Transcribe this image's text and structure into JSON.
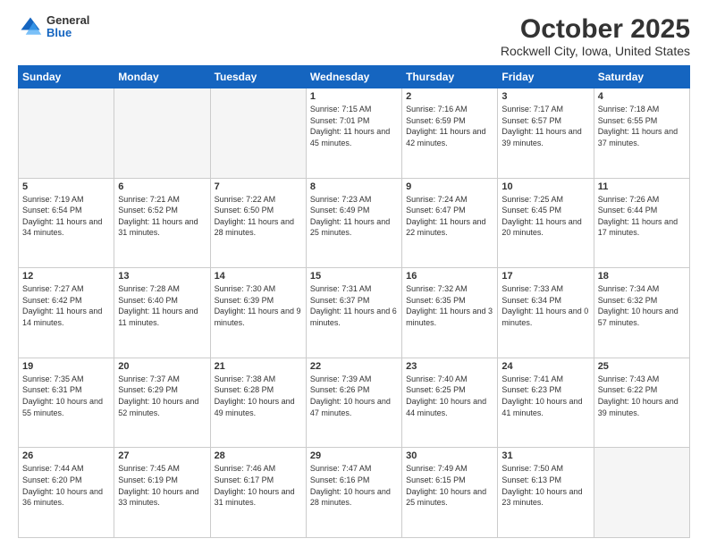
{
  "header": {
    "logo_general": "General",
    "logo_blue": "Blue",
    "month_title": "October 2025",
    "location": "Rockwell City, Iowa, United States"
  },
  "days_of_week": [
    "Sunday",
    "Monday",
    "Tuesday",
    "Wednesday",
    "Thursday",
    "Friday",
    "Saturday"
  ],
  "weeks": [
    [
      {
        "num": "",
        "empty": true
      },
      {
        "num": "",
        "empty": true
      },
      {
        "num": "",
        "empty": true
      },
      {
        "num": "1",
        "sunrise": "7:15 AM",
        "sunset": "7:01 PM",
        "daylight": "11 hours and 45 minutes."
      },
      {
        "num": "2",
        "sunrise": "7:16 AM",
        "sunset": "6:59 PM",
        "daylight": "11 hours and 42 minutes."
      },
      {
        "num": "3",
        "sunrise": "7:17 AM",
        "sunset": "6:57 PM",
        "daylight": "11 hours and 39 minutes."
      },
      {
        "num": "4",
        "sunrise": "7:18 AM",
        "sunset": "6:55 PM",
        "daylight": "11 hours and 37 minutes."
      }
    ],
    [
      {
        "num": "5",
        "sunrise": "7:19 AM",
        "sunset": "6:54 PM",
        "daylight": "11 hours and 34 minutes."
      },
      {
        "num": "6",
        "sunrise": "7:21 AM",
        "sunset": "6:52 PM",
        "daylight": "11 hours and 31 minutes."
      },
      {
        "num": "7",
        "sunrise": "7:22 AM",
        "sunset": "6:50 PM",
        "daylight": "11 hours and 28 minutes."
      },
      {
        "num": "8",
        "sunrise": "7:23 AM",
        "sunset": "6:49 PM",
        "daylight": "11 hours and 25 minutes."
      },
      {
        "num": "9",
        "sunrise": "7:24 AM",
        "sunset": "6:47 PM",
        "daylight": "11 hours and 22 minutes."
      },
      {
        "num": "10",
        "sunrise": "7:25 AM",
        "sunset": "6:45 PM",
        "daylight": "11 hours and 20 minutes."
      },
      {
        "num": "11",
        "sunrise": "7:26 AM",
        "sunset": "6:44 PM",
        "daylight": "11 hours and 17 minutes."
      }
    ],
    [
      {
        "num": "12",
        "sunrise": "7:27 AM",
        "sunset": "6:42 PM",
        "daylight": "11 hours and 14 minutes."
      },
      {
        "num": "13",
        "sunrise": "7:28 AM",
        "sunset": "6:40 PM",
        "daylight": "11 hours and 11 minutes."
      },
      {
        "num": "14",
        "sunrise": "7:30 AM",
        "sunset": "6:39 PM",
        "daylight": "11 hours and 9 minutes."
      },
      {
        "num": "15",
        "sunrise": "7:31 AM",
        "sunset": "6:37 PM",
        "daylight": "11 hours and 6 minutes."
      },
      {
        "num": "16",
        "sunrise": "7:32 AM",
        "sunset": "6:35 PM",
        "daylight": "11 hours and 3 minutes."
      },
      {
        "num": "17",
        "sunrise": "7:33 AM",
        "sunset": "6:34 PM",
        "daylight": "11 hours and 0 minutes."
      },
      {
        "num": "18",
        "sunrise": "7:34 AM",
        "sunset": "6:32 PM",
        "daylight": "10 hours and 57 minutes."
      }
    ],
    [
      {
        "num": "19",
        "sunrise": "7:35 AM",
        "sunset": "6:31 PM",
        "daylight": "10 hours and 55 minutes."
      },
      {
        "num": "20",
        "sunrise": "7:37 AM",
        "sunset": "6:29 PM",
        "daylight": "10 hours and 52 minutes."
      },
      {
        "num": "21",
        "sunrise": "7:38 AM",
        "sunset": "6:28 PM",
        "daylight": "10 hours and 49 minutes."
      },
      {
        "num": "22",
        "sunrise": "7:39 AM",
        "sunset": "6:26 PM",
        "daylight": "10 hours and 47 minutes."
      },
      {
        "num": "23",
        "sunrise": "7:40 AM",
        "sunset": "6:25 PM",
        "daylight": "10 hours and 44 minutes."
      },
      {
        "num": "24",
        "sunrise": "7:41 AM",
        "sunset": "6:23 PM",
        "daylight": "10 hours and 41 minutes."
      },
      {
        "num": "25",
        "sunrise": "7:43 AM",
        "sunset": "6:22 PM",
        "daylight": "10 hours and 39 minutes."
      }
    ],
    [
      {
        "num": "26",
        "sunrise": "7:44 AM",
        "sunset": "6:20 PM",
        "daylight": "10 hours and 36 minutes."
      },
      {
        "num": "27",
        "sunrise": "7:45 AM",
        "sunset": "6:19 PM",
        "daylight": "10 hours and 33 minutes."
      },
      {
        "num": "28",
        "sunrise": "7:46 AM",
        "sunset": "6:17 PM",
        "daylight": "10 hours and 31 minutes."
      },
      {
        "num": "29",
        "sunrise": "7:47 AM",
        "sunset": "6:16 PM",
        "daylight": "10 hours and 28 minutes."
      },
      {
        "num": "30",
        "sunrise": "7:49 AM",
        "sunset": "6:15 PM",
        "daylight": "10 hours and 25 minutes."
      },
      {
        "num": "31",
        "sunrise": "7:50 AM",
        "sunset": "6:13 PM",
        "daylight": "10 hours and 23 minutes."
      },
      {
        "num": "",
        "empty": true
      }
    ]
  ]
}
